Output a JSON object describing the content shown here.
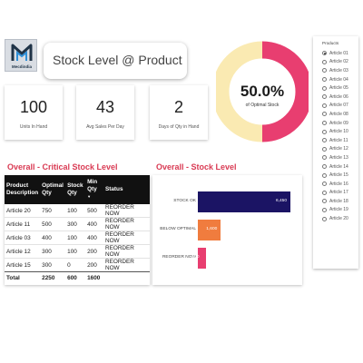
{
  "brand": {
    "logo_text": "Mecdindia"
  },
  "header": {
    "title": "Stock Level @ Product"
  },
  "kpis": [
    {
      "value": "100",
      "label": "Units In Hand"
    },
    {
      "value": "43",
      "label": "Avg Sales Per Day"
    },
    {
      "value": "2",
      "label": "Days of Qty in Hand"
    }
  ],
  "donut": {
    "percent_text": "50.0%",
    "label": "of Optimal Stock",
    "fraction": 0.5,
    "colors": {
      "filled": "#e83e70",
      "rest": "#faeab2"
    }
  },
  "slicer": {
    "title": "Products",
    "selected_index": 0,
    "items": [
      "Article 01",
      "Article 02",
      "Article 03",
      "Article 04",
      "Article 05",
      "Article 06",
      "Article 07",
      "Article 08",
      "Article 09",
      "Article 10",
      "Article 11",
      "Article 12",
      "Article 13",
      "Article 14",
      "Article 15",
      "Article 16",
      "Article 17",
      "Article 18",
      "Article 19",
      "Article 20"
    ]
  },
  "critical": {
    "title": "Overall - Critical Stock Level",
    "headers": [
      "Product Description",
      "Optimal Qty",
      "Stock Qty",
      "Min Qty",
      "Status"
    ],
    "rows": [
      [
        "Article 20",
        "750",
        "100",
        "500",
        "REORDER NOW"
      ],
      [
        "Article 11",
        "500",
        "300",
        "400",
        "REORDER NOW"
      ],
      [
        "Article 03",
        "400",
        "100",
        "400",
        "REORDER NOW"
      ],
      [
        "Article 12",
        "300",
        "100",
        "200",
        "REORDER NOW"
      ],
      [
        "Article 15",
        "300",
        "0",
        "200",
        "REORDER NOW"
      ]
    ],
    "total": [
      "Total",
      "2250",
      "600",
      "1600",
      ""
    ]
  },
  "stock_chart": {
    "title": "Overall - Stock Level",
    "chart_data": {
      "type": "bar",
      "orientation": "horizontal",
      "categories": [
        "STOCK OK",
        "BELOW OPTIMAL",
        "REORDER NOW"
      ],
      "values": [
        6450,
        1600,
        600
      ],
      "value_labels": [
        "6,450",
        "1,600",
        "600"
      ],
      "xlim": [
        0,
        6450
      ],
      "colors": [
        "#1b1464",
        "#f07c3e",
        "#e83e70"
      ]
    }
  }
}
